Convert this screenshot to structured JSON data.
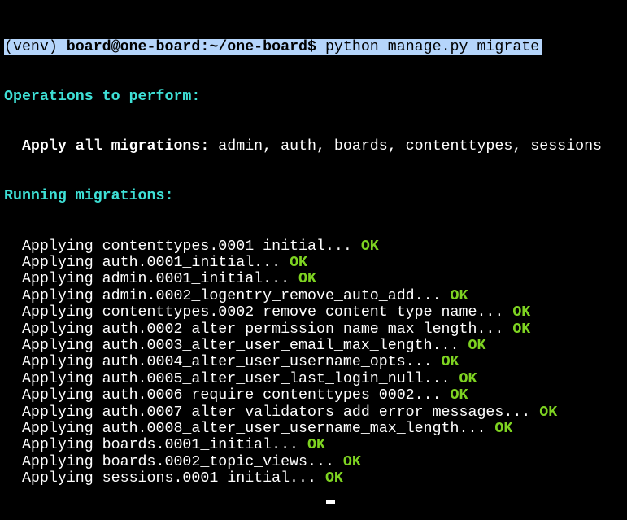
{
  "prompt": {
    "venv": "(venv) ",
    "user_host": "board@one-board",
    "path": ":~/one-board$",
    "command": " python manage.py migrate"
  },
  "operations_header": "Operations to perform:",
  "apply_all_label": "  Apply all migrations:",
  "apply_all_apps": " admin, auth, boards, contenttypes, sessions",
  "running_header": "Running migrations:",
  "migrations": [
    {
      "text": "  Applying contenttypes.0001_initial... ",
      "status": "OK"
    },
    {
      "text": "  Applying auth.0001_initial... ",
      "status": "OK"
    },
    {
      "text": "  Applying admin.0001_initial... ",
      "status": "OK"
    },
    {
      "text": "  Applying admin.0002_logentry_remove_auto_add... ",
      "status": "OK"
    },
    {
      "text": "  Applying contenttypes.0002_remove_content_type_name... ",
      "status": "OK"
    },
    {
      "text": "  Applying auth.0002_alter_permission_name_max_length... ",
      "status": "OK"
    },
    {
      "text": "  Applying auth.0003_alter_user_email_max_length... ",
      "status": "OK"
    },
    {
      "text": "  Applying auth.0004_alter_user_username_opts... ",
      "status": "OK"
    },
    {
      "text": "  Applying auth.0005_alter_user_last_login_null... ",
      "status": "OK"
    },
    {
      "text": "  Applying auth.0006_require_contenttypes_0002... ",
      "status": "OK"
    },
    {
      "text": "  Applying auth.0007_alter_validators_add_error_messages... ",
      "status": "OK"
    },
    {
      "text": "  Applying auth.0008_alter_user_username_max_length... ",
      "status": "OK"
    },
    {
      "text": "  Applying boards.0001_initial... ",
      "status": "OK"
    },
    {
      "text": "  Applying boards.0002_topic_views... ",
      "status": "OK"
    },
    {
      "text": "  Applying sessions.0001_initial... ",
      "status": "OK"
    }
  ],
  "colors": {
    "selection": "#b5d5fb",
    "header": "#3ee0d6",
    "ok": "#7ed321"
  }
}
